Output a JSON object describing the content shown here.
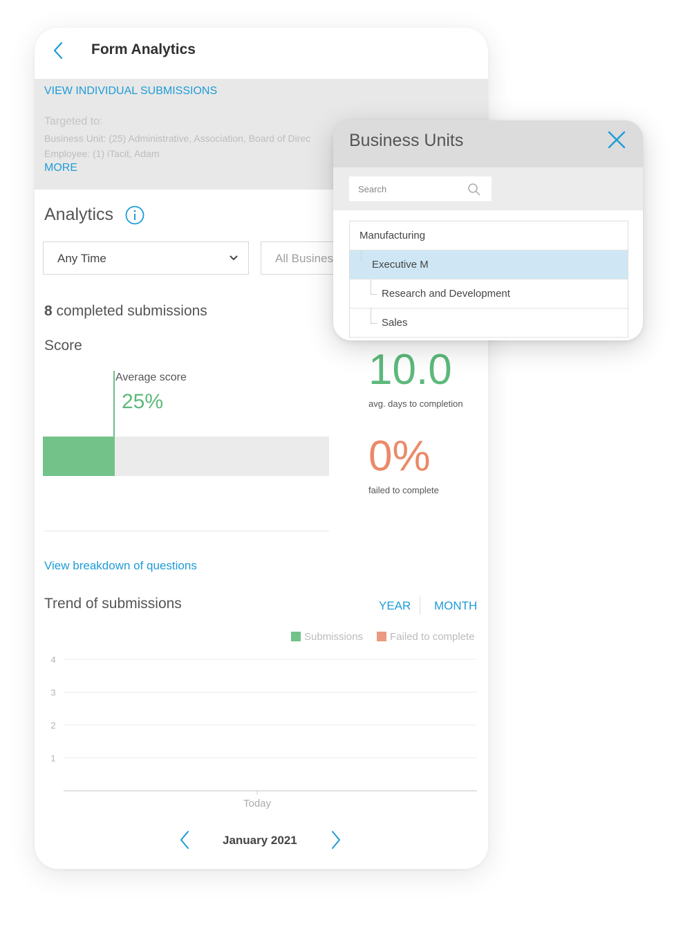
{
  "header": {
    "title": "Form Analytics"
  },
  "targeting": {
    "view_individual": "VIEW INDIVIDUAL SUBMISSIONS",
    "targeted_label": "Targeted to:",
    "business_units_line": "Business Unit: (25) Administrative, Association, Board of Direc",
    "employee_line": "Employee: (1) iTacit, Adam",
    "more": "MORE"
  },
  "analytics": {
    "title": "Analytics",
    "time_filter": "Any Time",
    "unit_filter": "All Busines",
    "completed_count": "8",
    "completed_text": "completed submissions",
    "score_title": "Score",
    "average_score_label": "Average score",
    "average_score_value": "25%",
    "average_score_fraction": 0.25,
    "avg_days_value": "10.0",
    "avg_days_label": "avg. days to completion",
    "failed_value": "0%",
    "failed_label": "failed to complete",
    "breakdown_link": "View breakdown of questions"
  },
  "trend": {
    "title": "Trend of submissions",
    "year": "YEAR",
    "month": "MONTH",
    "legend": [
      {
        "label": "Submissions",
        "color": "#72c289"
      },
      {
        "label": "Failed to complete",
        "color": "#ea9a80"
      }
    ],
    "month_label": "January 2021"
  },
  "chart_data": {
    "type": "bar",
    "categories": [
      "Today"
    ],
    "series": [
      {
        "name": "Submissions",
        "values": [
          0
        ]
      },
      {
        "name": "Failed to complete",
        "values": [
          0
        ]
      }
    ],
    "ylim": [
      0,
      4
    ],
    "yticks": [
      "1",
      "2",
      "3",
      "4"
    ],
    "grid": true,
    "legend_position": "top-right"
  },
  "popup": {
    "title": "Business Units",
    "search_placeholder": "Search",
    "items": [
      {
        "label": "Manufacturing",
        "level": 0,
        "selected": false
      },
      {
        "label": "Executive M",
        "level": 1,
        "selected": true
      },
      {
        "label": "Research and Development",
        "level": 2,
        "selected": false
      },
      {
        "label": "Sales",
        "level": 2,
        "selected": false
      }
    ]
  },
  "colors": {
    "accent": "#1e9bd7",
    "positive": "#5cb97b",
    "warning": "#ea8a69",
    "selected_row": "#cfe7f4"
  }
}
